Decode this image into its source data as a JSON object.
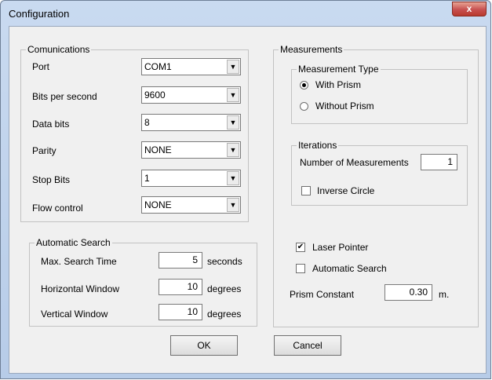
{
  "window": {
    "title": "Configuration",
    "close_glyph": "x"
  },
  "communications": {
    "legend": "Comunications",
    "rows": [
      {
        "label": "Port",
        "value": "COM1"
      },
      {
        "label": "Bits per second",
        "value": "9600"
      },
      {
        "label": "Data bits",
        "value": "8"
      },
      {
        "label": "Parity",
        "value": "NONE"
      },
      {
        "label": "Stop Bits",
        "value": "1"
      },
      {
        "label": "Flow control",
        "value": "NONE"
      }
    ]
  },
  "automatic_search": {
    "legend": "Automatic Search",
    "rows": [
      {
        "label": "Max. Search Time",
        "value": "5",
        "unit": "seconds"
      },
      {
        "label": "Horizontal Window",
        "value": "10",
        "unit": "degrees"
      },
      {
        "label": "Vertical Window",
        "value": "10",
        "unit": "degrees"
      }
    ]
  },
  "measurements": {
    "legend": "Measurements",
    "type": {
      "legend": "Measurement Type",
      "options": [
        {
          "label": "With Prism",
          "selected": true
        },
        {
          "label": "Without Prism",
          "selected": false
        }
      ]
    },
    "iterations": {
      "legend": "Iterations",
      "num_label": "Number of Measurements",
      "num_value": "1",
      "inverse_label": "Inverse Circle",
      "inverse_checked": false
    },
    "laser_label": "Laser Pointer",
    "laser_checked": true,
    "auto_label": "Automatic Search",
    "auto_checked": false,
    "prism_label": "Prism Constant",
    "prism_value": "0.30",
    "prism_unit": "m."
  },
  "buttons": {
    "ok": "OK",
    "cancel": "Cancel"
  },
  "glyphs": {
    "dropdown": "▼",
    "check": "✔"
  }
}
